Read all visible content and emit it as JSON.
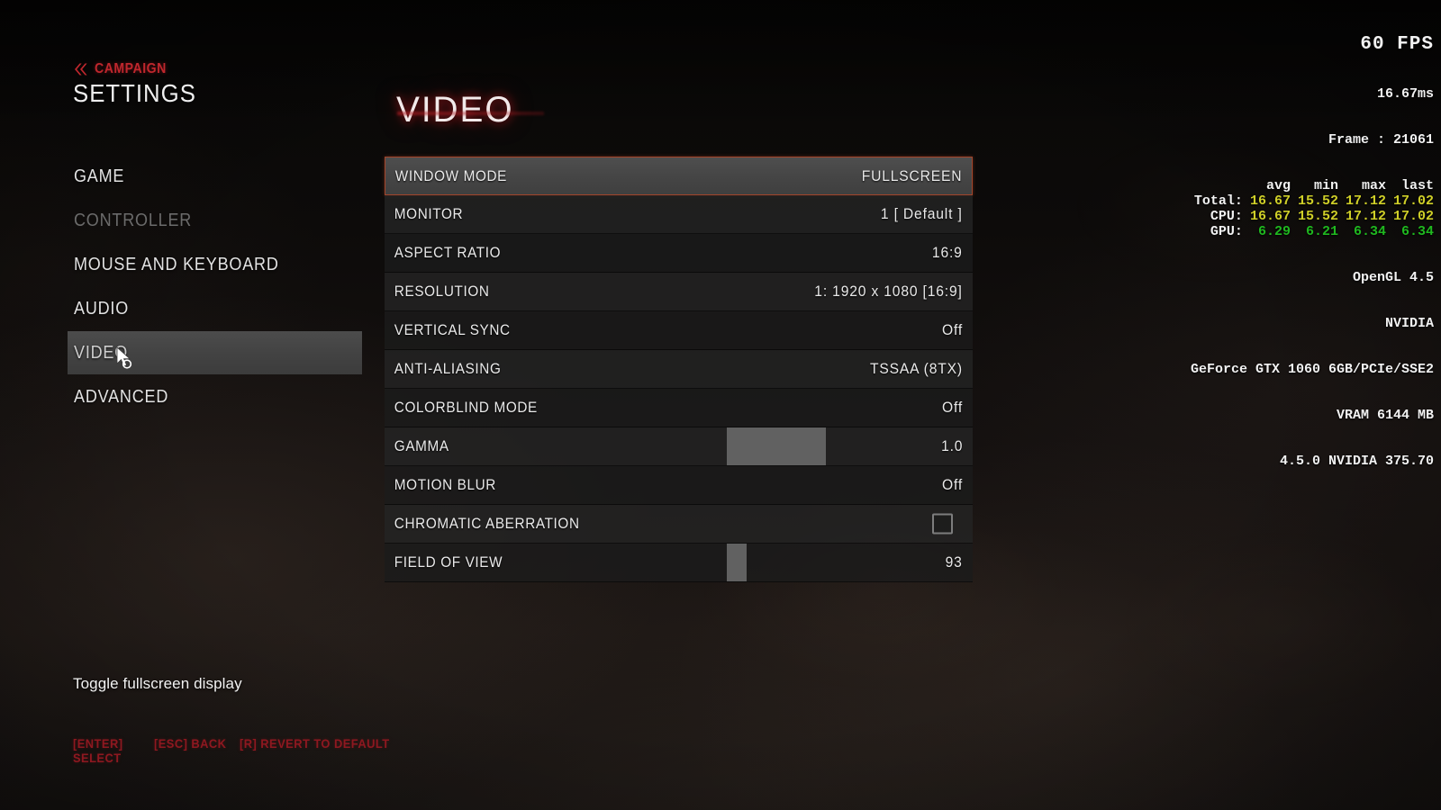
{
  "header": {
    "breadcrumb_label": "CAMPAIGN",
    "breadcrumb_icon": "double-chevron-left-icon",
    "title": "SETTINGS"
  },
  "sidebar": {
    "items": [
      {
        "label": "GAME",
        "state": "normal"
      },
      {
        "label": "CONTROLLER",
        "state": "disabled"
      },
      {
        "label": "MOUSE AND KEYBOARD",
        "state": "normal"
      },
      {
        "label": "AUDIO",
        "state": "normal"
      },
      {
        "label": "VIDEO",
        "state": "active"
      },
      {
        "label": "ADVANCED",
        "state": "normal"
      }
    ]
  },
  "panel": {
    "title": "VIDEO",
    "rows": [
      {
        "label": "WINDOW MODE",
        "value": "FULLSCREEN",
        "type": "option",
        "selected": true
      },
      {
        "label": "MONITOR",
        "value": "1 [ Default ]",
        "type": "option",
        "selected": false
      },
      {
        "label": "ASPECT RATIO",
        "value": "16:9",
        "type": "option",
        "selected": false
      },
      {
        "label": "RESOLUTION",
        "value": "1: 1920 x 1080 [16:9]",
        "type": "option",
        "selected": false
      },
      {
        "label": "VERTICAL SYNC",
        "value": "Off",
        "type": "option",
        "selected": false
      },
      {
        "label": "ANTI-ALIASING",
        "value": "TSSAA (8TX)",
        "type": "option",
        "selected": false
      },
      {
        "label": "COLORBLIND MODE",
        "value": "Off",
        "type": "option",
        "selected": false
      },
      {
        "label": "GAMMA",
        "value": "1.0",
        "type": "slider",
        "selected": false,
        "fill_percent": 40
      },
      {
        "label": "MOTION BLUR",
        "value": "Off",
        "type": "option",
        "selected": false
      },
      {
        "label": "CHROMATIC ABERRATION",
        "value": "",
        "type": "checkbox",
        "selected": false,
        "checked": false
      },
      {
        "label": "FIELD OF VIEW",
        "value": "93",
        "type": "slider",
        "selected": false,
        "fill_percent": 8
      }
    ]
  },
  "footer": {
    "description": "Toggle fullscreen display",
    "key_hints": [
      {
        "label": "[ENTER] SELECT"
      },
      {
        "label": "[ESC] BACK"
      },
      {
        "label": "[R] REVERT TO DEFAULT"
      }
    ]
  },
  "perf_overlay": {
    "fps": "60 FPS",
    "frametime": "16.67ms",
    "frame": "Frame : 21061",
    "columns": [
      "avg",
      "min",
      "max",
      "last"
    ],
    "rows": [
      {
        "name": "Total:",
        "avg": "16.67",
        "min": "15.52",
        "max": "17.12",
        "last": "17.02",
        "color": "#cfcf28"
      },
      {
        "name": "CPU:",
        "avg": "16.67",
        "min": "15.52",
        "max": "17.12",
        "last": "17.02",
        "color": "#cfcf28"
      },
      {
        "name": "GPU:",
        "avg": "6.29",
        "min": "6.21",
        "max": "6.34",
        "last": "6.34",
        "color": "#1fb81f"
      }
    ],
    "api": "OpenGL 4.5",
    "vendor": "NVIDIA",
    "renderer": "GeForce GTX 1060 6GB/PCIe/SSE2",
    "vram": "VRAM 6144 MB",
    "driver": "4.5.0 NVIDIA 375.70"
  },
  "colors": {
    "accent_red": "#c0272d",
    "selection_border": "#a4452a",
    "hint_red": "#8e1820"
  }
}
